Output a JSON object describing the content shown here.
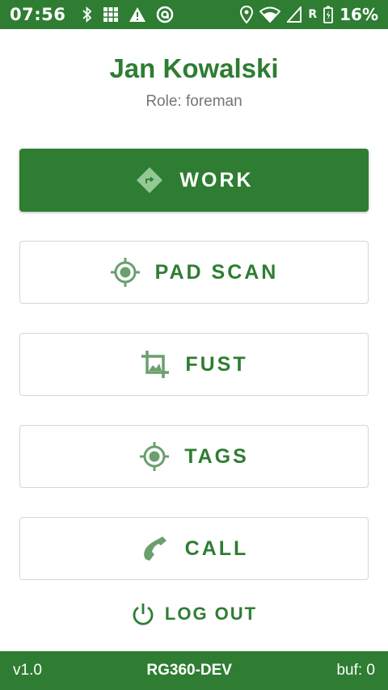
{
  "status_bar": {
    "time": "07:56",
    "battery_percent": "16%",
    "signal_label": "R",
    "icons": [
      "bluetooth-icon",
      "grid-icon",
      "warning-icon",
      "at-icon",
      "location-icon",
      "wifi-icon",
      "cell-signal-icon",
      "battery-charging-icon"
    ]
  },
  "user": {
    "name": "Jan Kowalski",
    "role": "Role: foreman"
  },
  "menu": {
    "work": "WORK",
    "pad_scan": "PAD SCAN",
    "fust": "FUST",
    "tags": "TAGS",
    "call": "CALL"
  },
  "logout_label": "LOG OUT",
  "footer": {
    "version": "v1.0",
    "device": "RG360-DEV",
    "buffer": "buf: 0"
  },
  "colors": {
    "primary": "#2e7d32",
    "icon_tint": "#6a9f6e",
    "role_text": "#757575",
    "border": "#d6d6d6"
  }
}
